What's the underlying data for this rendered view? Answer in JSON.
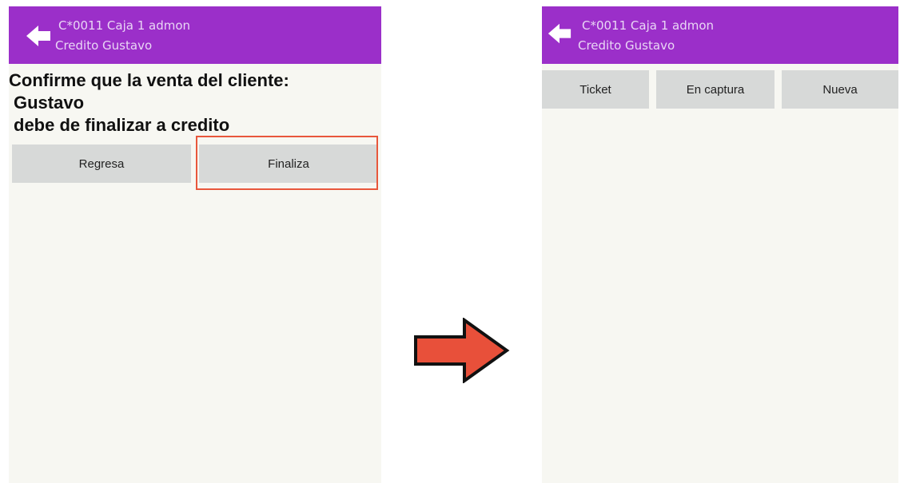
{
  "left_screen": {
    "header": {
      "line1": "C*0011 Caja 1 admon",
      "line2": "Credito Gustavo",
      "back_icon": "arrow-left-icon"
    },
    "message": {
      "line1": "Confirme que la venta del cliente:",
      "line2": "Gustavo",
      "line3": "debe de finalizar a credito"
    },
    "buttons": {
      "regresa": "Regresa",
      "finaliza": "Finaliza"
    },
    "highlight_color": "#e8573c"
  },
  "right_screen": {
    "header": {
      "line1": "C*0011 Caja 1 admon",
      "line2": "Credito Gustavo",
      "back_icon": "arrow-left-icon"
    },
    "buttons": {
      "ticket": "Ticket",
      "en_captura": "En captura",
      "nueva": "Nueva"
    }
  },
  "transition_arrow": {
    "icon": "arrow-right-icon",
    "color": "#e8503a"
  },
  "colors": {
    "appbar": "#9b2fc9",
    "screen_bg": "#f7f7f2",
    "button_bg": "#d7d9d8"
  }
}
